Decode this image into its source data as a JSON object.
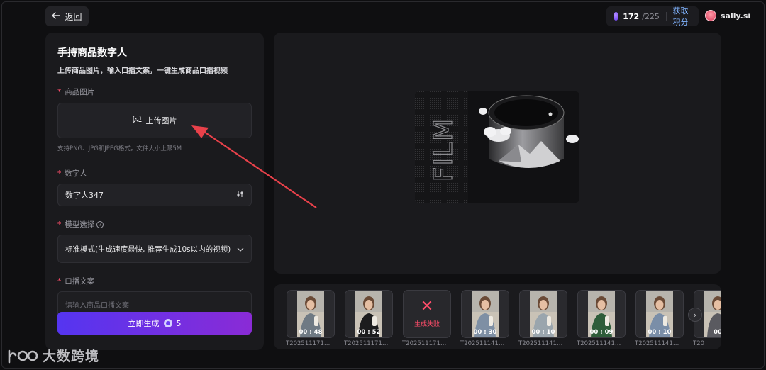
{
  "header": {
    "back_label": "返回",
    "credits_used": "172",
    "credits_total": "/225",
    "get_credits_label": "获取积分",
    "username": "sally.si"
  },
  "form": {
    "title": "手持商品数字人",
    "subtitle": "上传商品图片，输入口播文案，一键生成商品口播视频",
    "product_image_label": "商品图片",
    "upload_label": "上传图片",
    "upload_hint": "支持PNG、JPG和JPEG格式，文件大小上限5M",
    "avatar_label": "数字人",
    "avatar_value": "数字人347",
    "model_label": "模型选择",
    "model_value": "标准模式(生成速度最快, 推荐生成10s以内的视频)",
    "script_label": "口播文案",
    "script_placeholder": "请输入商品口播文案",
    "generate_label": "立即生成",
    "generate_cost": "5"
  },
  "preview": {
    "film_text": "FILM"
  },
  "thumbnails": [
    {
      "duration": "00 : 48",
      "name": "T202511171…",
      "status": "ok",
      "shirt": "#6f7a84"
    },
    {
      "duration": "00 : 52",
      "name": "T202511171…",
      "status": "ok",
      "shirt": "#1c1c1e"
    },
    {
      "fail_text": "生成失败",
      "name": "T202511171…",
      "status": "fail"
    },
    {
      "duration": "00 : 30",
      "name": "T202511141…",
      "status": "ok",
      "shirt": "#7e8fa4"
    },
    {
      "duration": "00 : 10",
      "name": "T202511141…",
      "status": "ok",
      "shirt": "#9aa5ad"
    },
    {
      "duration": "00 : 09",
      "name": "T202511141…",
      "status": "ok",
      "shirt": "#2e5d3a"
    },
    {
      "duration": "00 : 10",
      "name": "T202511141…",
      "status": "ok",
      "shirt": "#7a8ea8"
    },
    {
      "duration": "00",
      "name": "T20",
      "status": "ok",
      "shirt": "#5a5a60"
    }
  ],
  "watermark": {
    "text": "大数跨境"
  },
  "colors": {
    "accent_start": "#5535f0",
    "accent_end": "#8a2bd6",
    "error": "#ff4d6a",
    "link": "#7fb3ff",
    "annotation_arrow": "#e8414a"
  }
}
